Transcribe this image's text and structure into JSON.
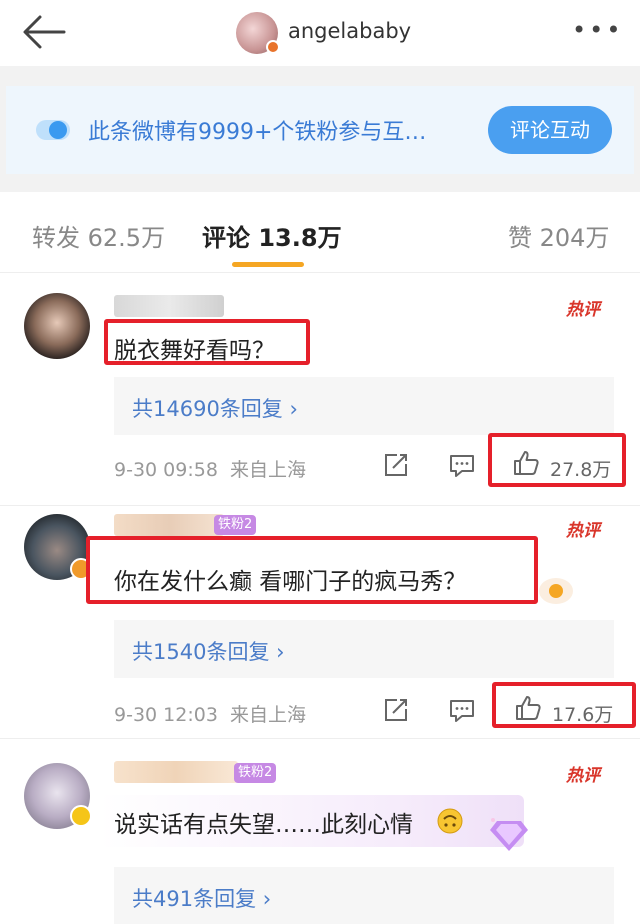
{
  "header": {
    "back_icon": "arrow-left-icon",
    "username": "angelababy",
    "more_icon": "more-dots-icon",
    "more_label": "•••"
  },
  "banner": {
    "text": "此条微博有9999+个铁粉参与互…",
    "button": "评论互动"
  },
  "tabs": [
    {
      "label": "转发 62.5万"
    },
    {
      "label": "评论 13.8万"
    },
    {
      "label": "赞 204万"
    }
  ],
  "hot_tag": "热评",
  "comments": [
    {
      "text": "脱衣舞好看吗？",
      "fan_badge": "",
      "replies": "共14690条回复 ›",
      "time": "9-30 09:58",
      "location": "来自上海",
      "likes": "27.8万"
    },
    {
      "text": "你在发什么癫 看哪门子的疯马秀？",
      "fan_badge": "铁粉2",
      "replies": "共1540条回复 ›",
      "time": "9-30 12:03",
      "location": "来自上海",
      "likes": "17.6万"
    },
    {
      "text": "说实话有点失望……此刻心情",
      "fan_badge": "铁粉2",
      "replies": "共491条回复 ›"
    }
  ],
  "colors": {
    "accent": "#f5a623",
    "link": "#4b7cc8",
    "highlight": "#e5202a",
    "hot": "#d9352a"
  }
}
